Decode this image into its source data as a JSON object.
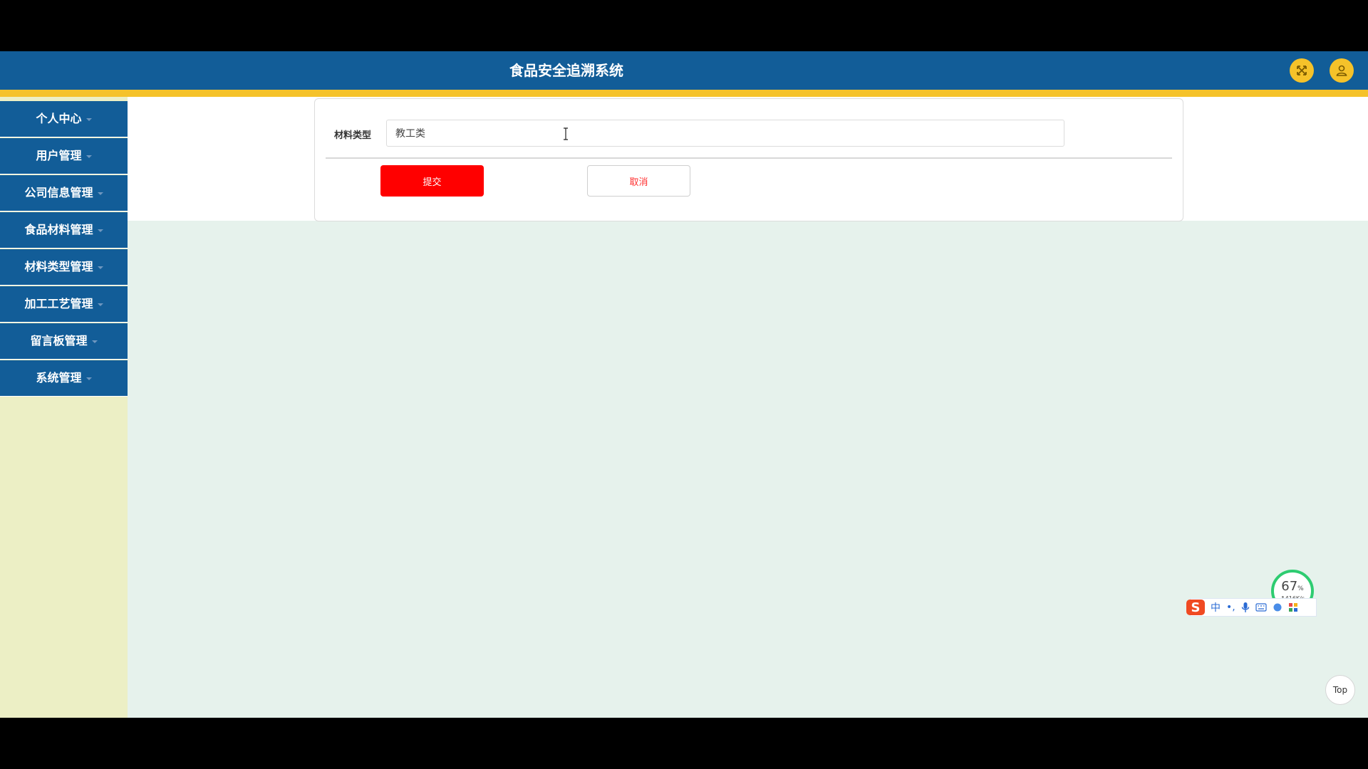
{
  "header": {
    "title": "食品安全追溯系统",
    "fullscreen_icon": "expand-arrows-icon",
    "user_icon": "user-icon"
  },
  "sidebar": {
    "items": [
      {
        "label": "个人中心"
      },
      {
        "label": "用户管理"
      },
      {
        "label": "公司信息管理"
      },
      {
        "label": "食品材料管理"
      },
      {
        "label": "材料类型管理"
      },
      {
        "label": "加工工艺管理"
      },
      {
        "label": "留言板管理"
      },
      {
        "label": "系统管理"
      }
    ]
  },
  "form": {
    "field_label": "材料类型",
    "field_value": "教工类",
    "submit_label": "提交",
    "cancel_label": "取消"
  },
  "widgets": {
    "network_percent": "67",
    "network_percent_unit": "%",
    "network_speed": "↑416K/s",
    "ime_logo": "S",
    "ime_mode": "中",
    "ime_punct": "•,",
    "top_label": "Top"
  },
  "colors": {
    "header_bg": "#125d98",
    "accent": "#f5c22a",
    "submit": "#ff0000",
    "sidebar_bg": "#ecefc5",
    "content_bg": "#e6f2ec"
  }
}
